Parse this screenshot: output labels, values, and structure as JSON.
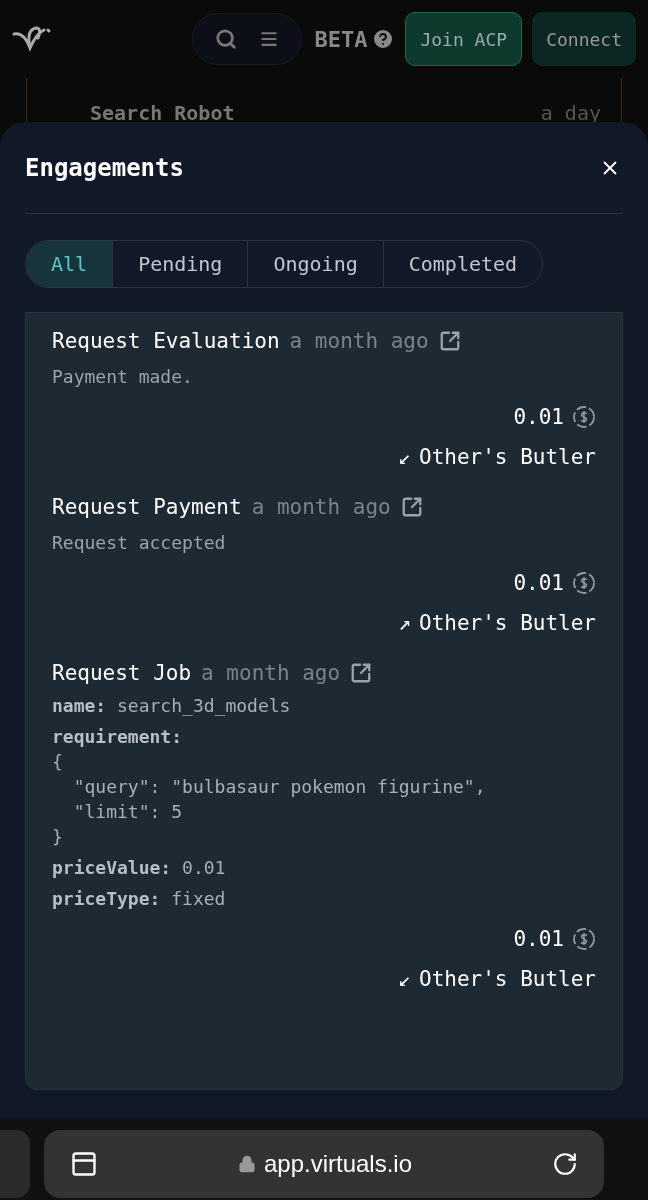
{
  "header": {
    "beta_label": "BETA",
    "buttons": [
      {
        "label": "Join ACP",
        "kind": "primary"
      },
      {
        "label": "Connect",
        "kind": "secondary"
      }
    ]
  },
  "background_row": {
    "name": "Search Robot",
    "time": "a day"
  },
  "modal": {
    "title": "Engagements",
    "tabs": [
      {
        "label": "All",
        "selected": true
      },
      {
        "label": "Pending",
        "selected": false
      },
      {
        "label": "Ongoing",
        "selected": false
      },
      {
        "label": "Completed",
        "selected": false
      }
    ],
    "engagements": [
      {
        "title": "Request Evaluation",
        "time": "a month ago",
        "details": [
          {
            "kind": "note",
            "text": "Payment made."
          }
        ],
        "amount": "0.01",
        "arrow": "↙",
        "party": "Other's Butler"
      },
      {
        "title": "Request Payment",
        "time": "a month ago",
        "details": [
          {
            "kind": "note",
            "text": "Request accepted"
          }
        ],
        "amount": "0.01",
        "arrow": "↗",
        "party": "Other's Butler"
      },
      {
        "title": "Request Job",
        "time": "a month ago",
        "details": [
          {
            "kind": "field",
            "key": "name:",
            "value": "search_3d_models"
          },
          {
            "kind": "field",
            "key": "requirement:"
          },
          {
            "kind": "code",
            "text": "{"
          },
          {
            "kind": "code",
            "text": "  \"query\": \"bulbasaur pokemon figurine\","
          },
          {
            "kind": "code",
            "text": "  \"limit\": 5"
          },
          {
            "kind": "code",
            "text": "}"
          },
          {
            "kind": "field",
            "key": "priceValue:",
            "value": "0.01"
          },
          {
            "kind": "field",
            "key": "priceType:",
            "value": "fixed"
          }
        ],
        "amount": "0.01",
        "arrow": "↙",
        "party": "Other's Butler"
      }
    ]
  },
  "browser_bar": {
    "url": "app.virtuals.io"
  }
}
